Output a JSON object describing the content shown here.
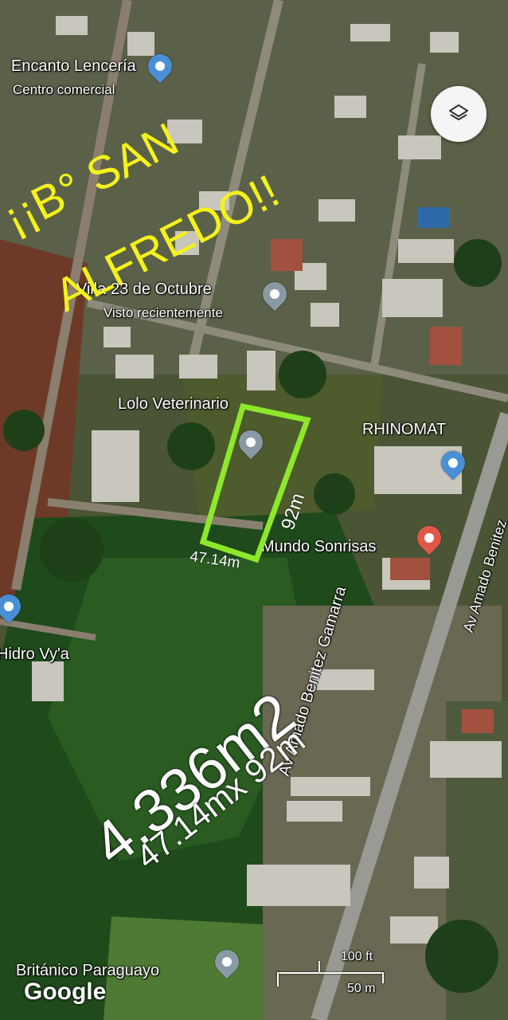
{
  "map": {
    "places": [
      {
        "name": "Encanto Lencería",
        "sub": "Centro comercial"
      },
      {
        "name": "Villa 23 de Octubre",
        "sub": "Visto recientemente"
      },
      {
        "name": "Lolo Veterinario"
      },
      {
        "name": "RHINOMAT"
      },
      {
        "name": "Mundo Sonrisas"
      },
      {
        "name": "Hidro Vy'a"
      },
      {
        "name": "Británico Paraguayo"
      }
    ],
    "streets": [
      "Av Amado Benitez Gamarra",
      "Av Amado Benitez"
    ],
    "logo": "Google",
    "scale": {
      "imperial": "100 ft",
      "metric": "50 m"
    }
  },
  "overlay": {
    "headline_line1": "¡¡B° SAN",
    "headline_line2": "ALFREDO!!",
    "dimension_side": "92m",
    "dimension_front": "47.14m",
    "area": "4.336m2",
    "area_formula": "47.14mx 92m"
  },
  "colors": {
    "headline": "#f4f21a",
    "plot_outline": "#8ee82a",
    "label_white": "#ffffff",
    "pin_blue": "#4a8fd6",
    "pin_red": "#e2574c",
    "pin_gray": "#8a9aa5"
  }
}
